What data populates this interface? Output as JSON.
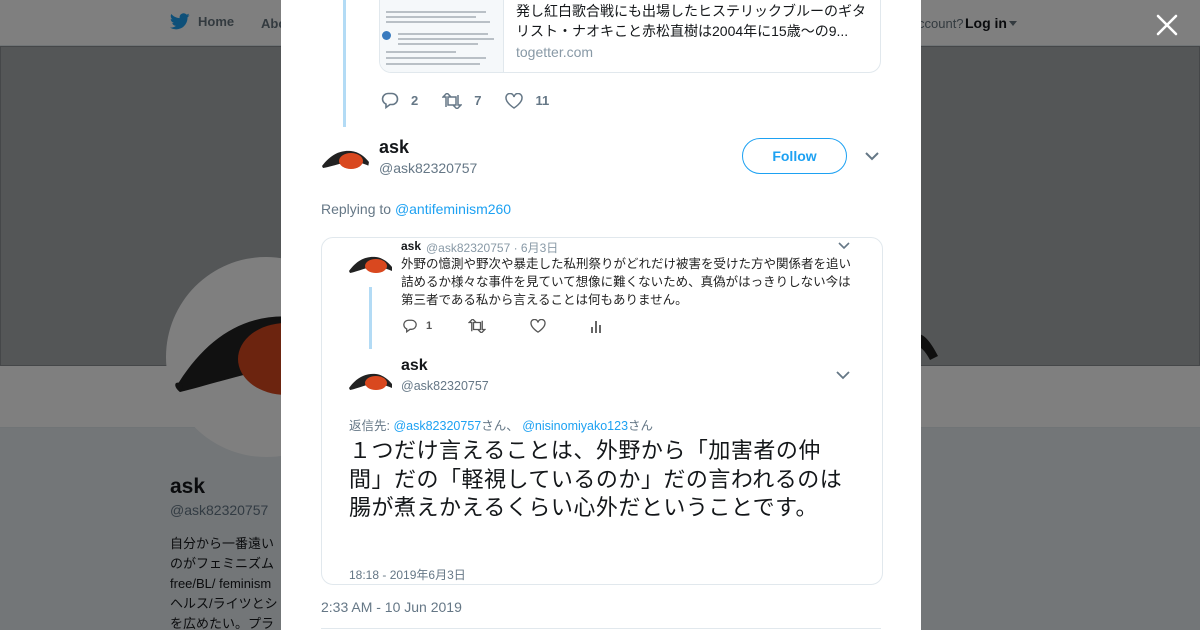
{
  "nav": {
    "home_label": "Home",
    "about_label": "Abo",
    "account_prompt": "ccount?",
    "login_label": "Log in"
  },
  "profile": {
    "name": "ask",
    "handle": "@ask82320757",
    "bio_lines": [
      "自分から一番遠い",
      "のがフェミニズム",
      "free/BL/ feminism",
      "ヘルス/ライツとシ",
      "を広めたい。プラ"
    ]
  },
  "modal": {
    "prev_card": {
      "title": "発し紅白歌合戦にも出場したヒステリックブルーのギタリスト・ナオキこと赤松直樹は2004年に15歳～の9...",
      "domain": "togetter.com"
    },
    "prev_actions": {
      "replies": "2",
      "retweets": "7",
      "likes": "11"
    },
    "tweet": {
      "name": "ask",
      "handle": "@ask82320757",
      "follow_label": "Follow",
      "replying_prefix": "Replying to",
      "replying_to": "@antifeminism260",
      "timestamp": "2:33 AM - 10 Jun 2019"
    },
    "embedded": {
      "name1": "ask",
      "handle1": "@ask82320757 · 6月3日",
      "body1": "外野の憶測や野次や暴走した私刑祭りがどれだけ被害を受けた方や関係者を追い詰めるか様々な事件を見ていて想像に難くないため、真偽がはっきりしない今は第三者である私から言えることは何もありません。",
      "reply_count1": "1",
      "name2": "ask",
      "handle2": "@ask82320757",
      "reply_prefix": "返信先:",
      "reply_user1": "@ask82320757",
      "reply_sep": "さん、",
      "reply_user2": "@nisinomiyako123",
      "reply_suffix": "さん",
      "big_text": "１つだけ言えることは、外野から「加害者の仲間」だの「軽視しているのか」だの言われるのは腸が煮えかえるくらい心外だということです。",
      "time": "18:18 - 2019年6月3日"
    }
  },
  "colors": {
    "accent": "#1da1f2",
    "thread_line": "#b3dbf5",
    "secondary_text": "#657786"
  }
}
